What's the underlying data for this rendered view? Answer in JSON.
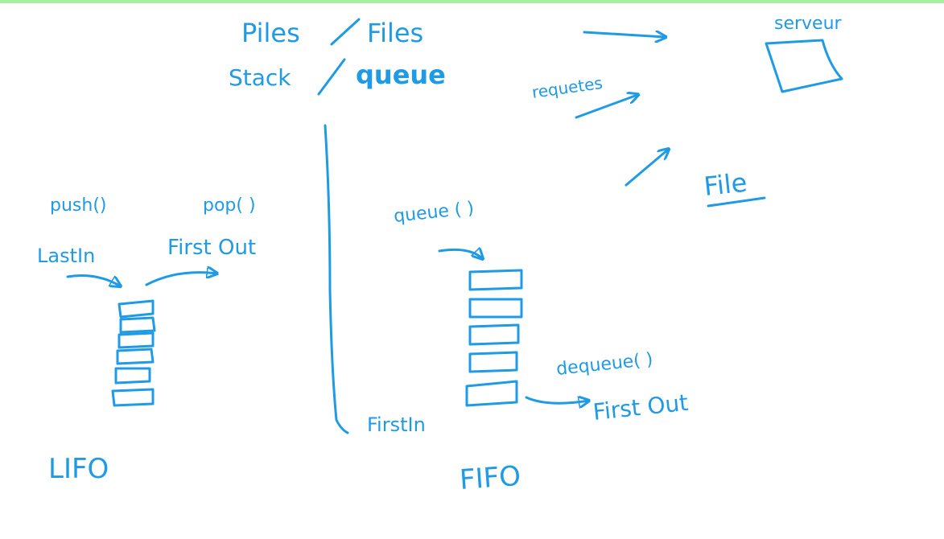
{
  "colors": {
    "ink": "#1f9be6",
    "top_border": "#a8f0a0",
    "background": "#ffffff"
  },
  "header": {
    "line1_left": "Piles",
    "line1_right": "Files",
    "line2_left": "Stack",
    "line2_right": "queue"
  },
  "server": {
    "label": "serveur",
    "requests_label": "requetes"
  },
  "file_label": "File",
  "lifo": {
    "push_label": "push()",
    "pop_label": "pop( )",
    "last_in_label": "LastIn",
    "first_out_label": "First Out",
    "title": "LIFO"
  },
  "fifo": {
    "queue_label": "queue ( )",
    "dequeue_label": "dequeue( )",
    "first_out_label": "First Out",
    "first_in_label": "FirstIn",
    "title": "FIFO"
  }
}
